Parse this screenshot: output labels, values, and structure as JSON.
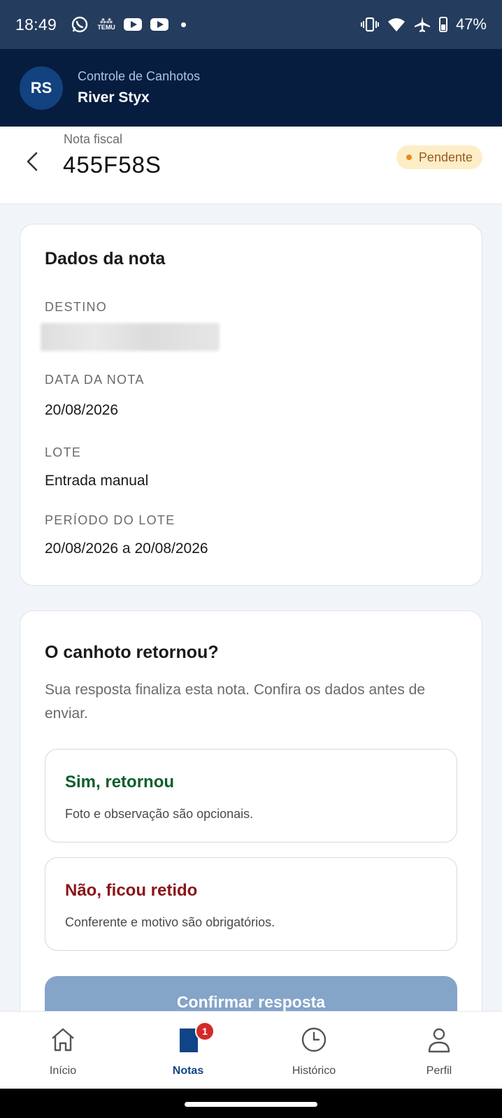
{
  "status_bar": {
    "time": "18:49",
    "battery": "47%",
    "icons": [
      "whatsapp-icon",
      "temu-icon",
      "youtube-icon",
      "youtube-icon",
      "notification-dot",
      "vibrate-icon",
      "wifi-icon",
      "airplane-icon",
      "battery-icon"
    ],
    "temu_label": "TEMU"
  },
  "header": {
    "avatar_initials": "RS",
    "subtitle": "Controle de Canhotos",
    "title": "River Styx"
  },
  "nota": {
    "label": "Nota fiscal",
    "number": "455F58S",
    "status": "Pendente"
  },
  "dados": {
    "title": "Dados da nota",
    "destino_label": "DESTINO",
    "data_label": "DATA DA NOTA",
    "data_value": "20/08/2026",
    "lote_label": "LOTE",
    "lote_value": "Entrada manual",
    "periodo_label": "PERÍODO DO LOTE",
    "periodo_value": "20/08/2026 a 20/08/2026"
  },
  "canhoto": {
    "title": "O canhoto retornou?",
    "description": "Sua resposta finaliza esta nota. Confira os dados antes de enviar.",
    "option_yes_title": "Sim, retornou",
    "option_yes_desc": "Foto e observação são opcionais.",
    "option_no_title": "Não, ficou retido",
    "option_no_desc": "Conferente e motivo são obrigatórios.",
    "confirm_label": "Confirmar resposta"
  },
  "bottom_nav": {
    "items": [
      {
        "label": "Início",
        "icon": "home-icon"
      },
      {
        "label": "Notas",
        "icon": "notes-icon",
        "badge": "1"
      },
      {
        "label": "Histórico",
        "icon": "clock-icon"
      },
      {
        "label": "Perfil",
        "icon": "person-icon"
      }
    ]
  },
  "colors": {
    "header_bg": "#061d3f",
    "status_bar_bg": "#243c5e",
    "accent": "#0f4487",
    "pending_bg": "#fdeec8",
    "pending_text": "#9a5a1b",
    "yes_color": "#0c5e2c",
    "no_color": "#8b1518",
    "confirm_disabled": "#84a4c8"
  }
}
